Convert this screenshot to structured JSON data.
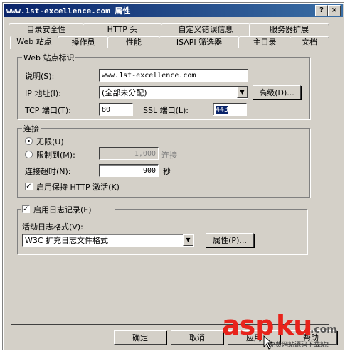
{
  "window": {
    "title": "www.1st-excellence.com 属性",
    "help_btn": "?",
    "close_btn": "×"
  },
  "tabs_back": [
    "目录安全性",
    "HTTP 头",
    "自定义错误信息",
    "服务器扩展"
  ],
  "tabs_front": [
    "Web 站点",
    "操作员",
    "性能",
    "ISAPI 筛选器",
    "主目录",
    "文档"
  ],
  "identity": {
    "legend": "Web 站点标识",
    "desc_label": "说明(S):",
    "desc_value": "www.1st-excellence.com",
    "ip_label": "IP 地址(I):",
    "ip_value": "(全部未分配)",
    "advanced_btn": "高级(D)...",
    "tcp_label": "TCP 端口(T):",
    "tcp_value": "80",
    "ssl_label": "SSL 端口(L):",
    "ssl_value": "443"
  },
  "connection": {
    "legend": "连接",
    "unlimited": "无限(U)",
    "limit_to": "限制到(M):",
    "limit_value": "1,000",
    "limit_unit": "连接",
    "timeout_label": "连接超时(N):",
    "timeout_value": "900",
    "timeout_unit": "秒",
    "keepalive": "启用保持 HTTP 激活(K)"
  },
  "logging": {
    "enable": "启用日志记录(E)",
    "format_label": "活动日志格式(V):",
    "format_value": "W3C 扩充日志文件格式",
    "props_btn": "属性(P)..."
  },
  "footer": {
    "ok": "确定",
    "cancel": "取消",
    "apply": "应用",
    "help": "帮助"
  },
  "watermark": {
    "brand_a": "asp",
    "brand_b": "ku",
    "brand_c": ".com",
    "tagline": "免费网站源码下载站!"
  },
  "colors": {
    "titlebar": "#0a246a",
    "dialog": "#d4d0c8",
    "watermark_red": "#e8231b"
  }
}
